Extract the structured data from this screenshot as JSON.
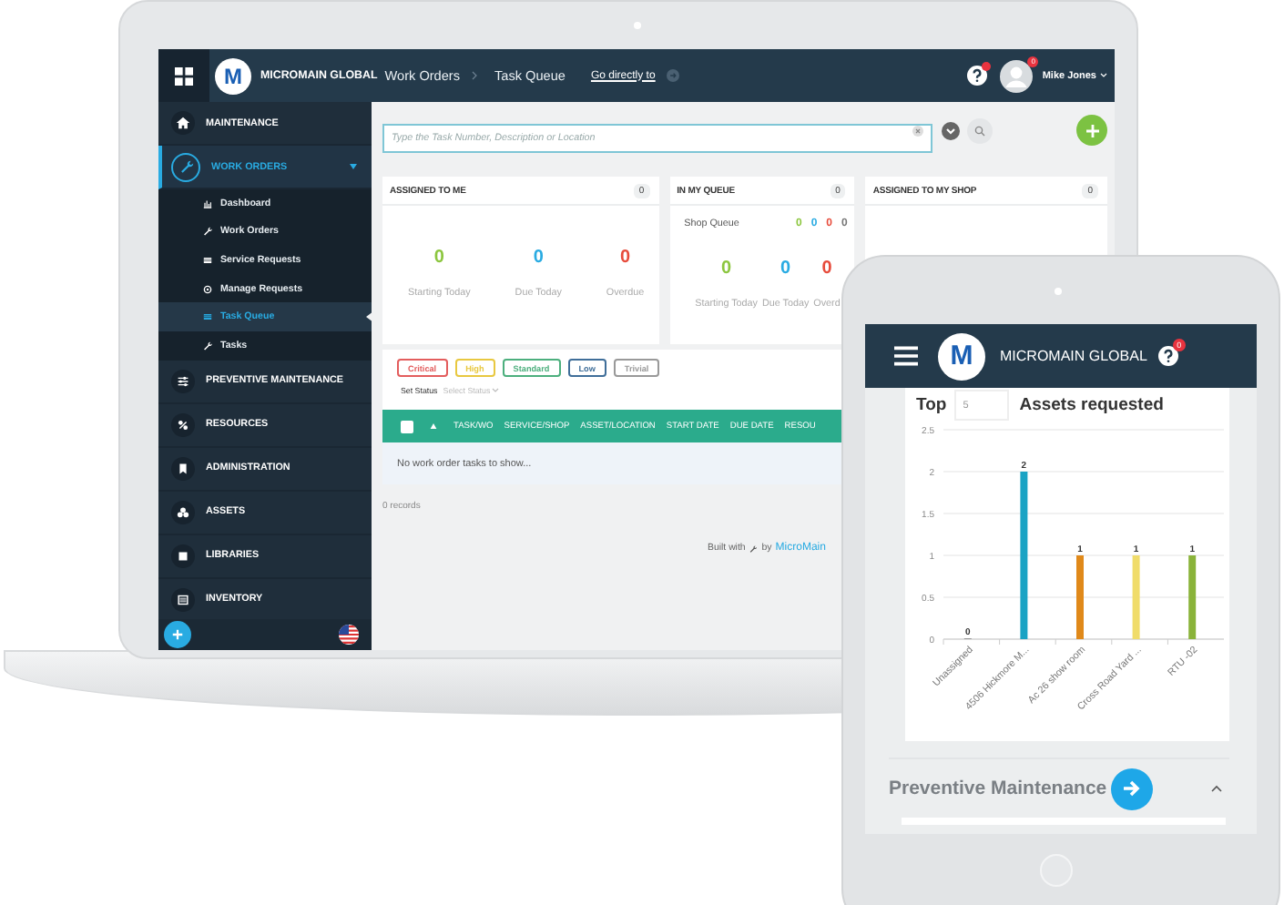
{
  "laptop": {
    "header": {
      "logo_mark": "M",
      "app_name": "MICROMAIN GLOBAL",
      "breadcrumbs": [
        "Work Orders",
        "Task Queue"
      ],
      "go_link": "Go directly to",
      "user_badge": "0",
      "user_name": "Mike Jones"
    },
    "sidebar": {
      "items": [
        {
          "label": "MAINTENANCE",
          "expanded": false
        },
        {
          "label": "WORK ORDERS",
          "expanded": true,
          "children": [
            {
              "label": "Dashboard",
              "selected": false
            },
            {
              "label": "Work Orders",
              "selected": false
            },
            {
              "label": "Service Requests",
              "selected": false
            },
            {
              "label": "Manage Requests",
              "selected": false
            },
            {
              "label": "Task Queue",
              "selected": true
            },
            {
              "label": "Tasks",
              "selected": false
            }
          ]
        },
        {
          "label": "PREVENTIVE MAINTENANCE",
          "expanded": false
        },
        {
          "label": "RESOURCES",
          "expanded": false
        },
        {
          "label": "ADMINISTRATION",
          "expanded": false
        },
        {
          "label": "ASSETS",
          "expanded": false
        },
        {
          "label": "LIBRARIES",
          "expanded": false
        },
        {
          "label": "INVENTORY",
          "expanded": false
        }
      ]
    },
    "search": {
      "placeholder": "Type the Task Number, Description or Location"
    },
    "cards": [
      {
        "title": "ASSIGNED TO ME",
        "count": "0",
        "stats": [
          {
            "value": "0",
            "label": "Starting Today",
            "color": "#8cc63f"
          },
          {
            "value": "0",
            "label": "Due Today",
            "color": "#29abe2"
          },
          {
            "value": "0",
            "label": "Overdue",
            "color": "#e74c3c"
          }
        ]
      },
      {
        "title": "IN MY QUEUE",
        "count": "0",
        "shop_queue": {
          "label": "Shop Queue",
          "values": [
            {
              "value": "0",
              "color": "#8cc63f"
            },
            {
              "value": "0",
              "color": "#29abe2"
            },
            {
              "value": "0",
              "color": "#e74c3c"
            },
            {
              "value": "0",
              "color": "#777777"
            }
          ]
        },
        "stats": [
          {
            "value": "0",
            "label": "Starting Today",
            "color": "#8cc63f"
          },
          {
            "value": "0",
            "label": "Due Today",
            "color": "#29abe2"
          },
          {
            "value": "0",
            "label": "Overd",
            "color": "#e74c3c"
          }
        ]
      },
      {
        "title": "ASSIGNED TO MY SHOP",
        "count": "0"
      }
    ],
    "priorities": [
      {
        "label": "Critical",
        "color": "#e35d5d"
      },
      {
        "label": "High",
        "color": "#e8c840"
      },
      {
        "label": "Standard",
        "color": "#4caf7d"
      },
      {
        "label": "Low",
        "color": "#3f6e99"
      },
      {
        "label": "Trivial",
        "color": "#999999"
      }
    ],
    "status_filter": {
      "label": "Set Status",
      "placeholder": "Select Status"
    },
    "table": {
      "select_all_checked": false,
      "columns": [
        "TASK/WO",
        "SERVICE/SHOP",
        "ASSET/LOCATION",
        "START DATE",
        "DUE DATE",
        "RESOU"
      ],
      "empty_message": "No work order tasks to show...",
      "record_count": "0 records"
    },
    "footer": {
      "built_with": "Built with",
      "by": "by",
      "brand": "MicroMain"
    }
  },
  "tablet": {
    "header": {
      "logo_mark": "M",
      "app_name": "MICROMAIN GLOBAL",
      "help_badge": "0"
    },
    "widget": {
      "top_label": "Top",
      "top_value": "5",
      "title": "Assets requested",
      "chart_data": {
        "type": "bar",
        "categories": [
          "Unassigned",
          "4506 Hickmore M...",
          "Ac 26 show room",
          "Cross Road Yard ...",
          "RTU -02"
        ],
        "series": [
          {
            "values": [
              0,
              2,
              1,
              1,
              1
            ]
          }
        ],
        "grid": true,
        "colors": [
          "#888888",
          "#1aa3c4",
          "#e0891a",
          "#f0dc6a",
          "#8ab33a"
        ],
        "ylim": [
          0,
          2.5
        ],
        "yticks": [
          0,
          0.5,
          1,
          1.5,
          2,
          2.5
        ],
        "data_labels": true
      }
    },
    "section": {
      "title": "Preventive Maintenance",
      "expanded": true
    }
  }
}
